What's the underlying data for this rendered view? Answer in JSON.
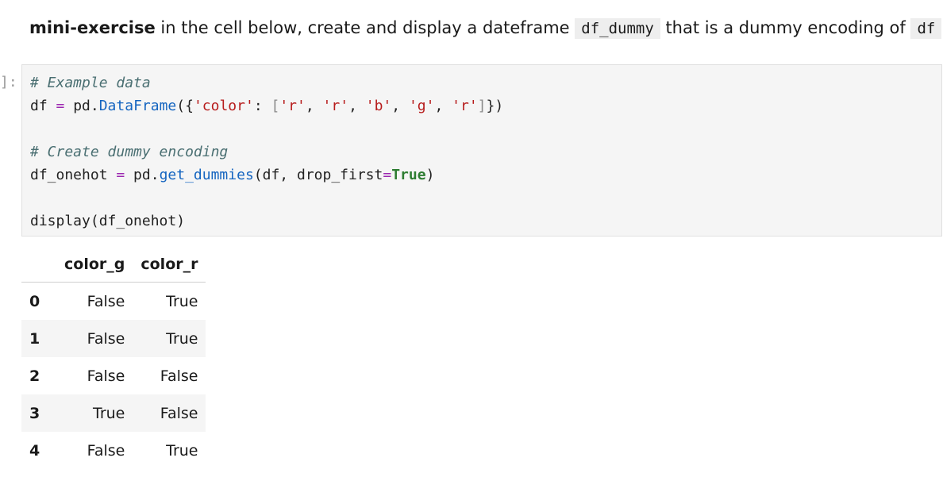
{
  "markdown": {
    "bold": "mini-exercise",
    "text1": " in the cell below, create and display a dateframe ",
    "code1": "df_dummy",
    "text2": " that is a dummy encoding of ",
    "code2": "df",
    "text3": "."
  },
  "cell": {
    "prompt": "]:",
    "lines": {
      "comment1": "# Example data",
      "l2_df": "df ",
      "l2_eq": "=",
      "l2_pd": " pd.",
      "l2_attr": "DataFrame",
      "l2_open": "({",
      "l2_key": "'color'",
      "l2_colon": ": ",
      "l2_lb": "[",
      "l2_v1": "'r'",
      "l2_c1": ", ",
      "l2_v2": "'r'",
      "l2_c2": ", ",
      "l2_v3": "'b'",
      "l2_c3": ", ",
      "l2_v4": "'g'",
      "l2_c4": ", ",
      "l2_v5": "'r'",
      "l2_rb": "]",
      "l2_close": "})",
      "comment2": "# Create dummy encoding",
      "l5_var": "df_onehot ",
      "l5_eq": "=",
      "l5_pd": " pd.",
      "l5_attr": "get_dummies",
      "l5_args": "(df, drop_first",
      "l5_eq2": "=",
      "l5_kw": "True",
      "l5_close": ")",
      "l7": "display(df_onehot)"
    }
  },
  "output": {
    "columns": [
      "color_g",
      "color_r"
    ],
    "rows": [
      {
        "index": "0",
        "color_g": "False",
        "color_r": "True"
      },
      {
        "index": "1",
        "color_g": "False",
        "color_r": "True"
      },
      {
        "index": "2",
        "color_g": "False",
        "color_r": "False"
      },
      {
        "index": "3",
        "color_g": "True",
        "color_r": "False"
      },
      {
        "index": "4",
        "color_g": "False",
        "color_r": "True"
      }
    ]
  }
}
